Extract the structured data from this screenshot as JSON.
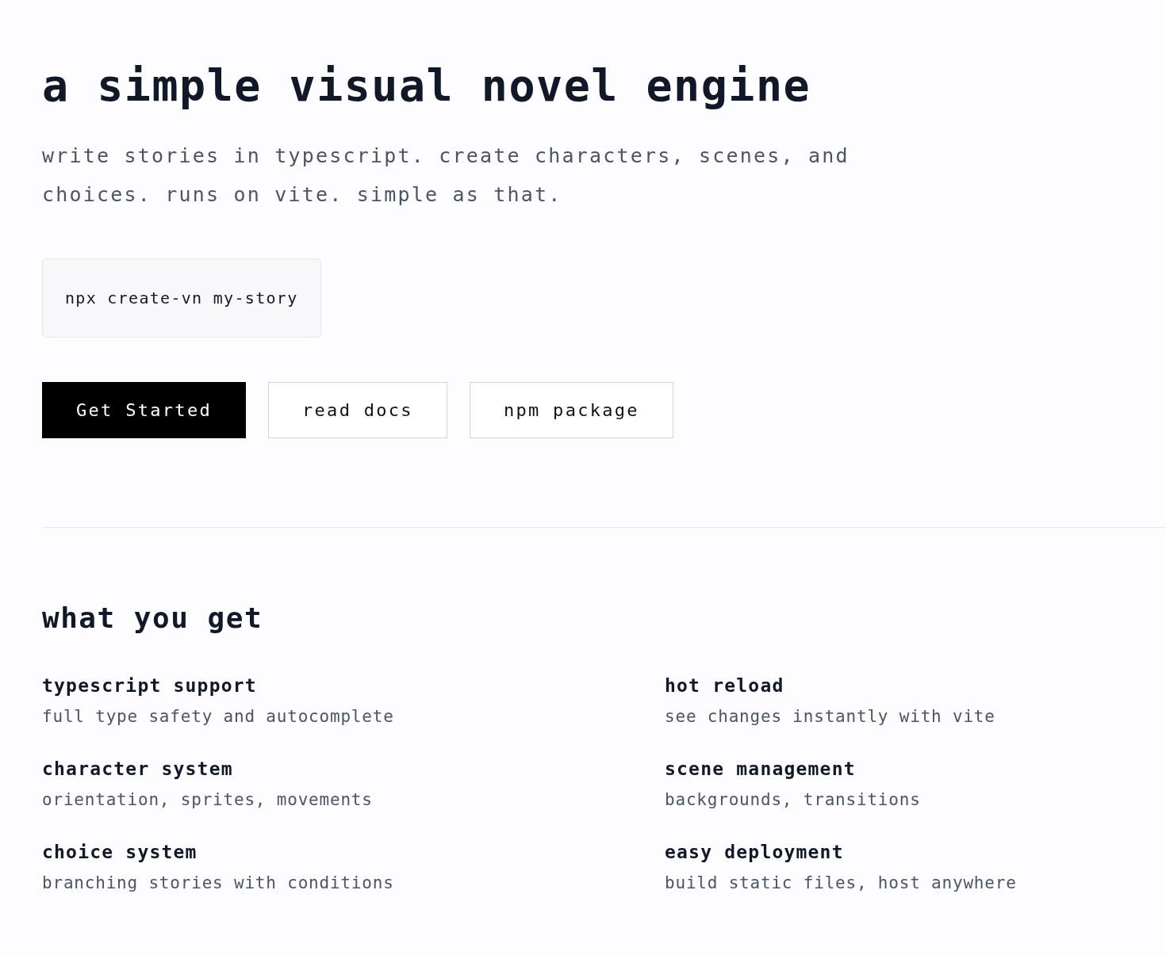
{
  "hero": {
    "title": "a simple visual novel engine",
    "subtitle": "write stories in typescript. create characters, scenes, and choices. runs on vite. simple as that.",
    "command": "npx create-vn my-story",
    "buttons": [
      {
        "label": "Get Started",
        "kind": "primary"
      },
      {
        "label": "read docs",
        "kind": "outline"
      },
      {
        "label": "npm package",
        "kind": "outline"
      }
    ]
  },
  "features": {
    "heading": "what you get",
    "items": [
      {
        "title": "typescript support",
        "description": "full type safety and autocomplete"
      },
      {
        "title": "hot reload",
        "description": "see changes instantly with vite"
      },
      {
        "title": "character system",
        "description": "orientation, sprites, movements"
      },
      {
        "title": "scene management",
        "description": "backgrounds, transitions"
      },
      {
        "title": "choice system",
        "description": "branching stories with conditions"
      },
      {
        "title": "easy deployment",
        "description": "build static files, host anywhere"
      }
    ]
  }
}
